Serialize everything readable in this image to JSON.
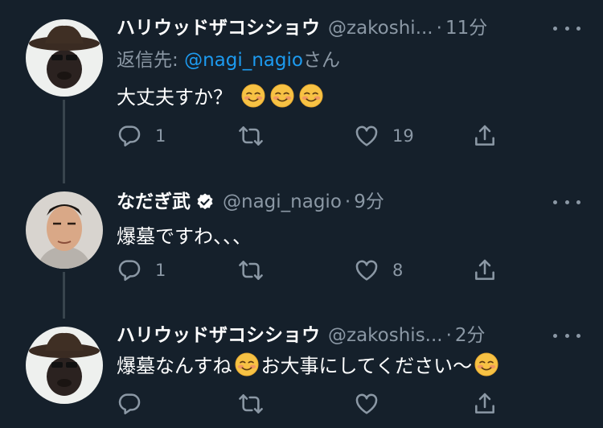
{
  "tweets": [
    {
      "name": "ハリウッドザコシショウ",
      "handle": "@zakoshi...",
      "time": "11分",
      "reply_prefix": "返信先: ",
      "reply_mention": "@nagi_nagio",
      "reply_suffix": "さん",
      "text": "大丈夫すか？",
      "trailing_emoji_count": 3,
      "replies": "1",
      "retweets": "",
      "likes": "19",
      "verified": false
    },
    {
      "name": "なだぎ武",
      "handle": "@nagi_nagio",
      "time": "9分",
      "text": "爆墓ですわ、、、",
      "replies": "1",
      "retweets": "",
      "likes": "8",
      "verified": true
    },
    {
      "name": "ハリウッドザコシショウ",
      "handle": "@zakoshis...",
      "time": "2分",
      "text_part1": "爆墓なんすね",
      "text_part2": "お大事にしてください〜",
      "replies": "",
      "retweets": "",
      "likes": "",
      "verified": false
    }
  ],
  "separator": "·",
  "colors": {
    "background": "#15202b",
    "secondary_text": "#8b98a5",
    "link": "#1d9bf0",
    "thread_line": "#38444d"
  },
  "icons": [
    "reply-icon",
    "retweet-icon",
    "like-icon",
    "share-icon",
    "more-icon",
    "verified-badge-icon",
    "smiling-face-emoji"
  ]
}
